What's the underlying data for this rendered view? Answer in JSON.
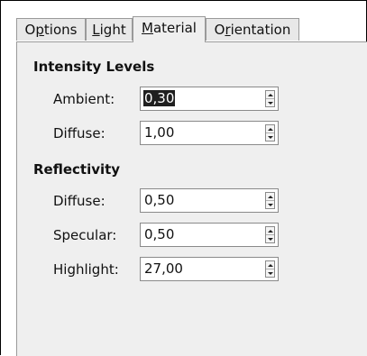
{
  "tabs": [
    {
      "label": "Options",
      "mnemonic_index": 1
    },
    {
      "label": "Light",
      "mnemonic_index": 0
    },
    {
      "label": "Material",
      "mnemonic_index": 0
    },
    {
      "label": "Orientation",
      "mnemonic_index": 1
    }
  ],
  "active_tab": "Material",
  "intensity": {
    "title": "Intensity Levels",
    "fields": [
      {
        "label": "Ambient:",
        "value": "0,30",
        "selected": true
      },
      {
        "label": "Diffuse:",
        "value": "1,00",
        "selected": false
      }
    ]
  },
  "reflectivity": {
    "title": "Reflectivity",
    "fields": [
      {
        "label": "Diffuse:",
        "value": "0,50"
      },
      {
        "label": "Specular:",
        "value": "0,50"
      },
      {
        "label": "Highlight:",
        "value": "27,00"
      }
    ]
  },
  "colors": {
    "panel_bg": "#efefef",
    "selection_bg": "#1f1f1f"
  }
}
